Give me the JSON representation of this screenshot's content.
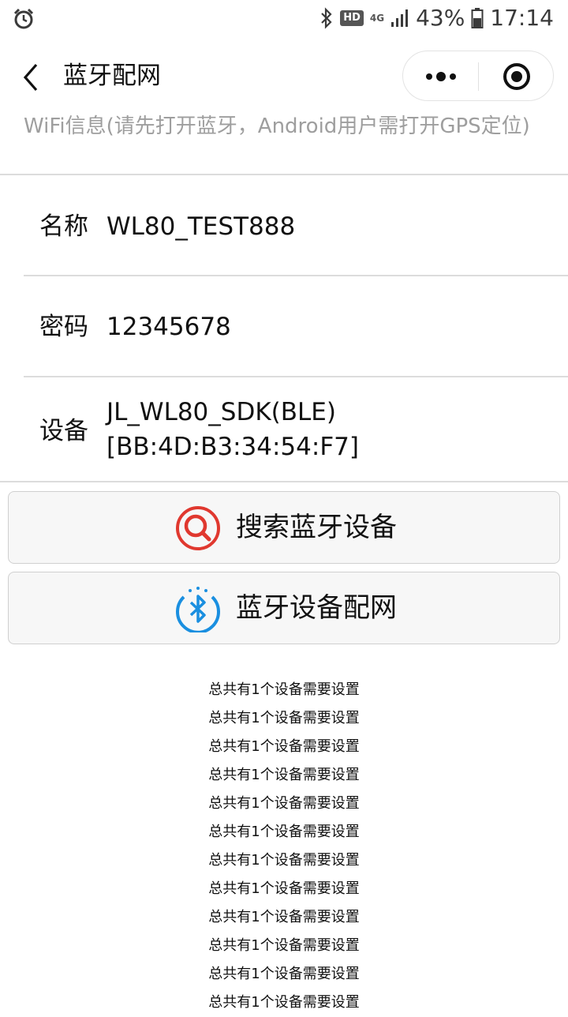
{
  "status_bar": {
    "hd": "HD",
    "network": "4G",
    "battery": "43%",
    "time": "17:14"
  },
  "nav": {
    "title": "蓝牙配网"
  },
  "hint": "WiFi信息(请先打开蓝牙，Android用户需打开GPS定位)",
  "fields": {
    "name_label": "名称",
    "name_value": "WL80_TEST888",
    "password_label": "密码",
    "password_value": "12345678",
    "device_label": "设备",
    "device_line1": "JL_WL80_SDK(BLE)",
    "device_line2": "[BB:4D:B3:34:54:F7]"
  },
  "buttons": {
    "search_label": "搜索蓝牙设备",
    "config_label": "蓝牙设备配网"
  },
  "log": [
    "总共有1个设备需要设置",
    "总共有1个设备需要设置",
    "总共有1个设备需要设置",
    "总共有1个设备需要设置",
    "总共有1个设备需要设置",
    "总共有1个设备需要设置",
    "总共有1个设备需要设置",
    "总共有1个设备需要设置",
    "总共有1个设备需要设置",
    "总共有1个设备需要设置",
    "总共有1个设备需要设置",
    "总共有1个设备需要设置"
  ],
  "colors": {
    "search_icon": "#e0382f",
    "bluetooth_icon": "#1a8fe0"
  }
}
